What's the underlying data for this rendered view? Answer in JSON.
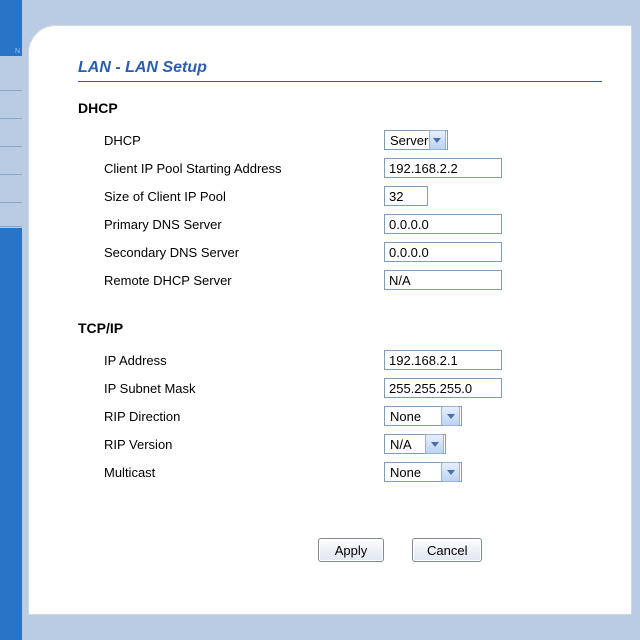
{
  "page": {
    "title": "LAN - LAN Setup"
  },
  "dhcp": {
    "heading": "DHCP",
    "mode_label": "DHCP",
    "mode_value": "Server",
    "pool_start_label": "Client IP Pool Starting Address",
    "pool_start_value": "192.168.2.2",
    "pool_size_label": "Size of Client IP Pool",
    "pool_size_value": "32",
    "primary_dns_label": "Primary DNS Server",
    "primary_dns_value": "0.0.0.0",
    "secondary_dns_label": "Secondary DNS Server",
    "secondary_dns_value": "0.0.0.0",
    "remote_label": "Remote DHCP Server",
    "remote_value": "N/A"
  },
  "tcpip": {
    "heading": "TCP/IP",
    "ip_label": "IP Address",
    "ip_value": "192.168.2.1",
    "mask_label": "IP Subnet Mask",
    "mask_value": "255.255.255.0",
    "rip_dir_label": "RIP Direction",
    "rip_dir_value": "None",
    "rip_ver_label": "RIP Version",
    "rip_ver_value": "N/A",
    "multicast_label": "Multicast",
    "multicast_value": "None"
  },
  "buttons": {
    "apply": "Apply",
    "cancel": "Cancel"
  }
}
